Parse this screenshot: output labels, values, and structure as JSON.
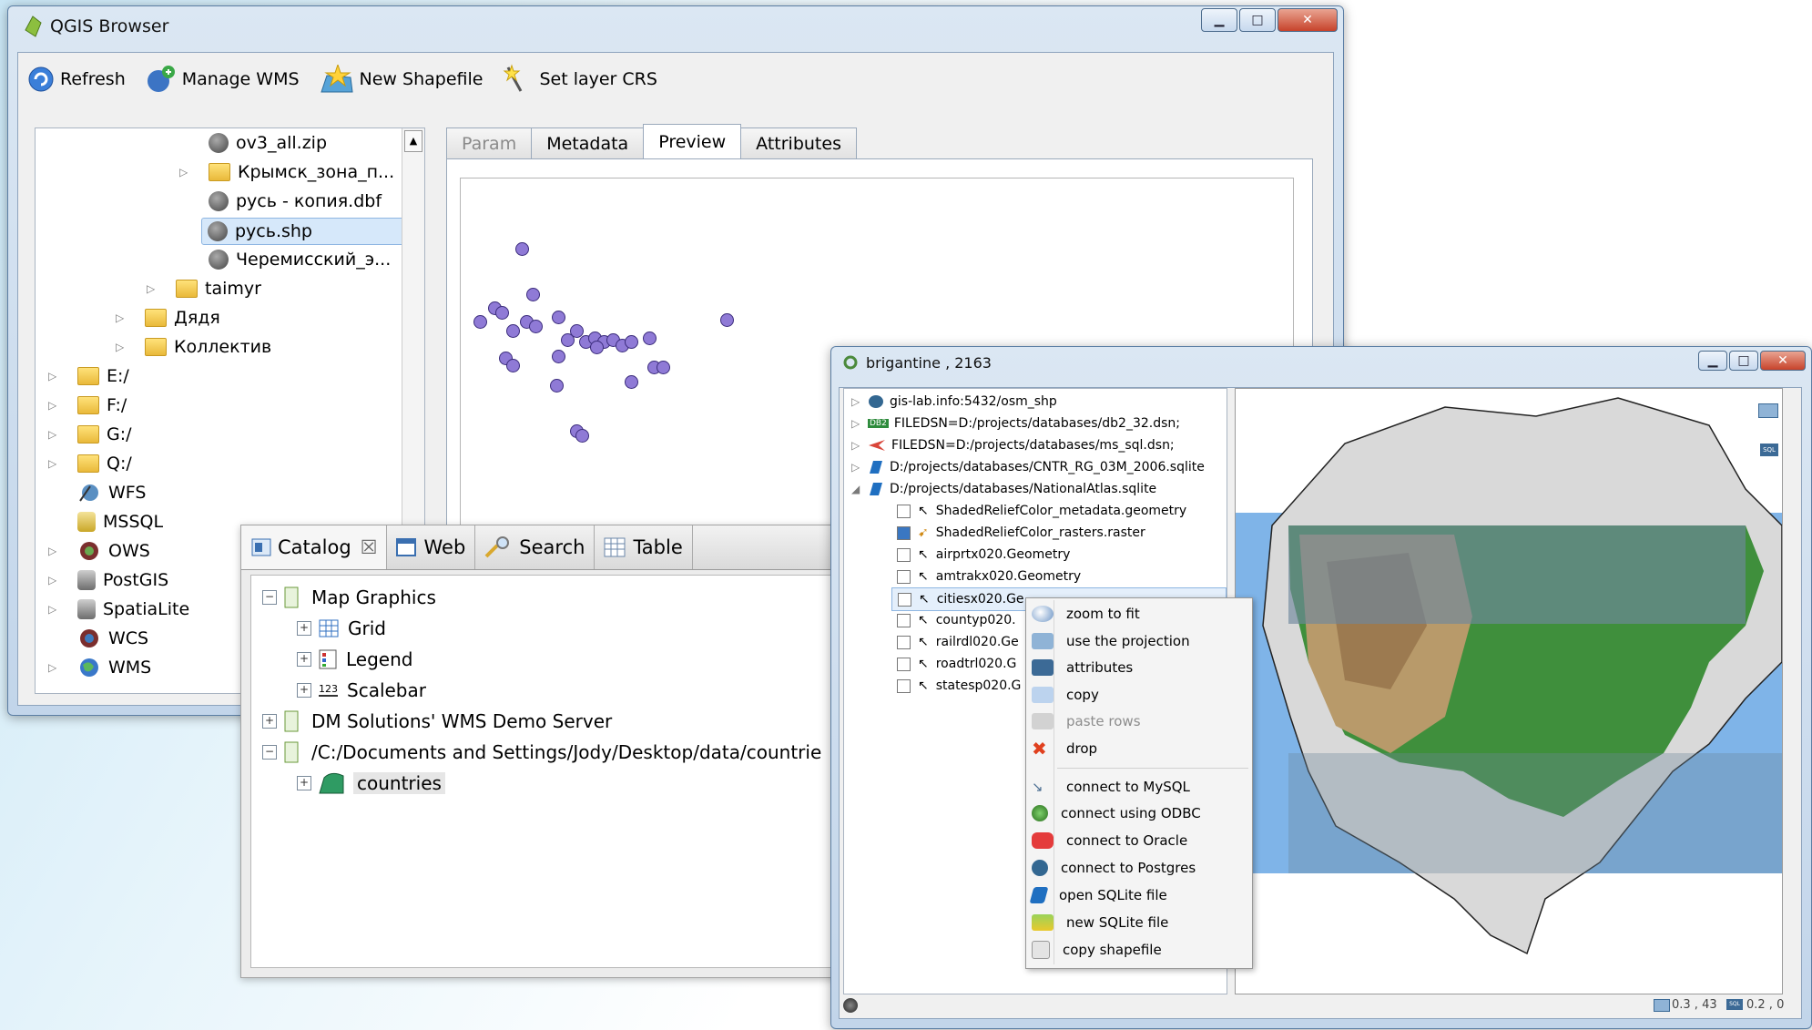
{
  "qgis": {
    "title": "QGIS Browser",
    "toolbar": {
      "refresh": "Refresh",
      "manage_wms": "Manage WMS",
      "new_shapefile": "New Shapefile",
      "set_layer_crs": "Set layer CRS"
    },
    "tree": [
      {
        "label": "ov3_all.zip",
        "icon": "shapefile-icon"
      },
      {
        "label": "Крымск_зона_п...",
        "icon": "folder-icon"
      },
      {
        "label": "русь - копия.dbf",
        "icon": "shapefile-icon"
      },
      {
        "label": "русь.shp",
        "icon": "shapefile-icon"
      },
      {
        "label": "Черемисский_э...",
        "icon": "shapefile-icon"
      },
      {
        "label": "taimyr",
        "icon": "folder-icon"
      },
      {
        "label": "Дядя",
        "icon": "folder-icon"
      },
      {
        "label": "Коллектив",
        "icon": "folder-icon"
      },
      {
        "label": "E:/",
        "icon": "folder-icon"
      },
      {
        "label": "F:/",
        "icon": "folder-icon"
      },
      {
        "label": "G:/",
        "icon": "folder-icon"
      },
      {
        "label": "Q:/",
        "icon": "folder-icon"
      },
      {
        "label": "WFS",
        "icon": "wfs-icon"
      },
      {
        "label": "MSSQL",
        "icon": "database-icon"
      },
      {
        "label": "OWS",
        "icon": "ows-icon"
      },
      {
        "label": "PostGIS",
        "icon": "database-icon"
      },
      {
        "label": "SpatiaLite",
        "icon": "database-icon"
      },
      {
        "label": "WCS",
        "icon": "wcs-icon"
      },
      {
        "label": "WMS",
        "icon": "globe-icon"
      }
    ],
    "tabs": [
      "Param",
      "Metadata",
      "Preview",
      "Attributes"
    ]
  },
  "catalog": {
    "tabs": [
      "Catalog",
      "Web",
      "Search",
      "Table"
    ],
    "tree": [
      "Map Graphics",
      "Grid",
      "Legend",
      "Scalebar",
      "DM Solutions' WMS Demo Server",
      "/C:/Documents and Settings/Jody/Desktop/data/countrie",
      "countries"
    ],
    "scalebar_glyph": "123"
  },
  "brig": {
    "title": "brigantine , 2163",
    "tree": [
      "gis-lab.info:5432/osm_shp",
      "FILEDSN=D:/projects/databases/db2_32.dsn;",
      "FILEDSN=D:/projects/databases/ms_sql.dsn;",
      "D:/projects/databases/CNTR_RG_03M_2006.sqlite",
      "D:/projects/databases/NationalAtlas.sqlite",
      "ShadedReliefColor_metadata.geometry",
      "ShadedReliefColor_rasters.raster",
      "airprtx020.Geometry",
      "amtrakx020.Geometry",
      "citiesx020.Ge",
      "countyp020.",
      "railrdl020.Ge",
      "roadtrl020.G",
      "statesp020.G"
    ],
    "db2_badge": "DB2",
    "menu": [
      "zoom to fit",
      "use the projection",
      "attributes",
      "copy",
      "paste rows",
      "drop",
      "connect to MySQL",
      "connect using ODBC",
      "connect to Oracle",
      "connect to Postgres",
      "open SQLite file",
      "new SQLite file",
      "copy shapefile"
    ],
    "status_left": "0.3 , 43",
    "status_right": "0.2 , 0",
    "sql_badge": "SQL"
  }
}
